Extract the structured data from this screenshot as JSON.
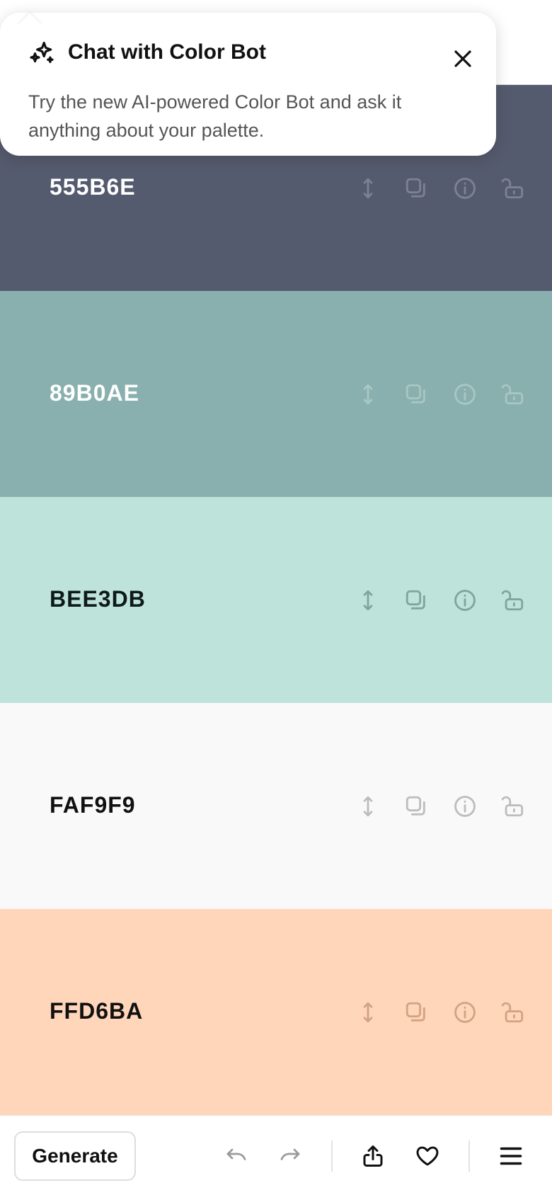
{
  "popup": {
    "title": "Chat with Color Bot",
    "body": "Try the new AI-powered Color Bot and ask it anything about your palette.",
    "icon": "sparkles-icon",
    "close_icon": "close-icon"
  },
  "palette": {
    "colors": [
      {
        "hex": "555B6E",
        "background": "#555B6E",
        "text_color": "#FFFFFF",
        "icon_color": "#7C8194",
        "icons": [
          "drag-arrows-icon",
          "copy-icon",
          "info-icon",
          "unlock-icon"
        ]
      },
      {
        "hex": "89B0AE",
        "background": "#89B0AE",
        "text_color": "#FFFFFF",
        "icon_color": "#A8C6C4",
        "icons": [
          "drag-arrows-icon",
          "copy-icon",
          "info-icon",
          "unlock-icon"
        ]
      },
      {
        "hex": "BEE3DB",
        "background": "#BEE3DB",
        "text_color": "#0E1A18",
        "icon_color": "#7FA59E",
        "icons": [
          "drag-arrows-icon",
          "copy-icon",
          "info-icon",
          "unlock-icon"
        ]
      },
      {
        "hex": "FAF9F9",
        "background": "#FAF9F9",
        "text_color": "#111111",
        "icon_color": "#BDBDBD",
        "icons": [
          "drag-arrows-icon",
          "copy-icon",
          "info-icon",
          "unlock-icon"
        ]
      },
      {
        "hex": "FFD6BA",
        "background": "#FFD6BA",
        "text_color": "#111111",
        "icon_color": "#D2A384",
        "icons": [
          "drag-arrows-icon",
          "copy-icon",
          "info-icon",
          "unlock-icon"
        ]
      }
    ]
  },
  "toolbar": {
    "generate_label": "Generate",
    "icons": [
      "undo-icon",
      "redo-icon",
      "share-icon",
      "heart-icon",
      "menu-icon"
    ],
    "undo_color": "#9A9A9A",
    "active_color": "#111111"
  }
}
